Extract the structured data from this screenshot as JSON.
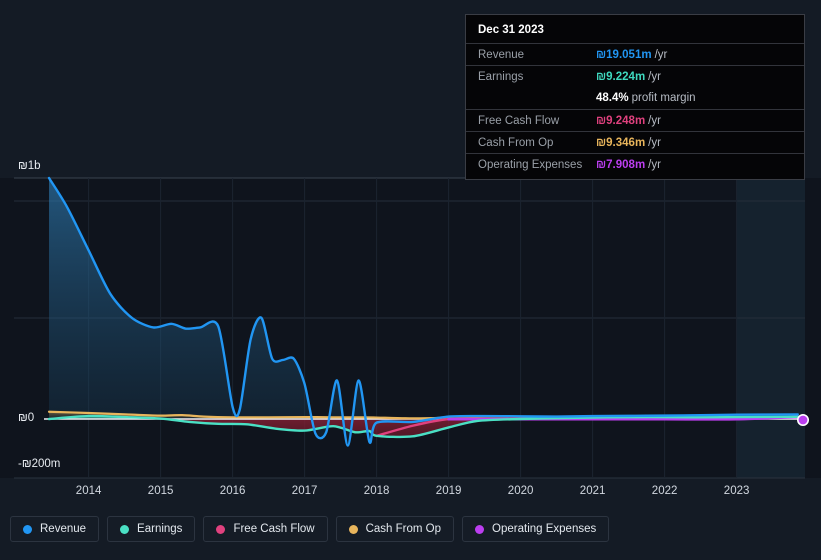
{
  "chart_data": {
    "type": "area",
    "title": "",
    "xlabel": "",
    "ylabel": "",
    "currency_symbol": "₪",
    "x": [
      2013.45,
      2014,
      2015,
      2016,
      2017,
      2018,
      2019,
      2020,
      2021,
      2022,
      2023,
      2023.85
    ],
    "xlim": [
      2013.45,
      2023.95
    ],
    "ylim": [
      -200000000,
      1050000000
    ],
    "grid": true,
    "legend_position": "bottom-left",
    "y_ticks": [
      {
        "label": "₪1b",
        "value": 1000000000
      },
      {
        "label": "₪0",
        "value": 0
      },
      {
        "label": "-₪200m",
        "value": -200000000
      }
    ],
    "x_ticks": [
      "2014",
      "2015",
      "2016",
      "2017",
      "2018",
      "2019",
      "2020",
      "2021",
      "2022",
      "2023"
    ],
    "forecast_band_start": "2023.0",
    "series": [
      {
        "name": "Revenue",
        "color": "#2196f3",
        "x": [
          2013.45,
          2013.7,
          2014.0,
          2014.3,
          2014.6,
          2014.9,
          2015.15,
          2015.35,
          2015.55,
          2015.8,
          2016.0,
          2016.1,
          2016.25,
          2016.4,
          2016.55,
          2016.7,
          2016.85,
          2017.0,
          2017.15,
          2017.3,
          2017.45,
          2017.6,
          2017.75,
          2017.9,
          2018.0,
          2018.5,
          2019.0,
          2019.5,
          2020.0,
          2020.5,
          2021.0,
          2021.5,
          2022.0,
          2022.5,
          2023.0,
          2023.85
        ],
        "values": [
          1000,
          880,
          700,
          520,
          420,
          380,
          395,
          375,
          380,
          385,
          50,
          40,
          330,
          420,
          250,
          245,
          250,
          145,
          -60,
          -55,
          160,
          -110,
          160,
          -95,
          -15,
          -12,
          10,
          12,
          11,
          10,
          12,
          13,
          14,
          16,
          18,
          19.051
        ],
        "units": "millions"
      },
      {
        "name": "Earnings",
        "color": "#4ae0c4",
        "x": [
          2013.45,
          2014.0,
          2014.5,
          2015.0,
          2015.4,
          2015.8,
          2016.2,
          2016.6,
          2017.0,
          2017.4,
          2017.7,
          2017.9,
          2018.0,
          2018.5,
          2019.0,
          2019.4,
          2020.0,
          2020.6,
          2021.2,
          2021.8,
          2022.4,
          2023.0,
          2023.85
        ],
        "values": [
          0,
          12,
          8,
          2,
          -12,
          -20,
          -22,
          -40,
          -48,
          -30,
          -55,
          -50,
          -70,
          -72,
          -35,
          -8,
          0,
          4,
          7,
          8,
          7,
          8,
          9.224
        ],
        "units": "millions"
      },
      {
        "name": "Free Cash Flow",
        "color": "#e0417e",
        "x": [
          2018.0,
          2018.5,
          2019.0,
          2019.5,
          2020.0,
          2021.0,
          2022.0,
          2023.0,
          2023.85
        ],
        "values": [
          -70,
          -28,
          0,
          1,
          1,
          1,
          1,
          1,
          9.248
        ],
        "units": "millions"
      },
      {
        "name": "Cash From Op",
        "color": "#e8b55c",
        "x": [
          2013.45,
          2014.0,
          2014.6,
          2015.0,
          2015.3,
          2015.6,
          2016.0,
          2016.5,
          2017.0,
          2017.4,
          2017.8,
          2018.0,
          2018.4,
          2018.8,
          2019.0,
          2019.5,
          2020.0,
          2021.0,
          2022.0,
          2023.0,
          2023.85
        ],
        "values": [
          30,
          25,
          18,
          14,
          16,
          10,
          7,
          7,
          8,
          7,
          7,
          6,
          3,
          4,
          6,
          3,
          2,
          2,
          2,
          2,
          9.346
        ],
        "units": "millions"
      },
      {
        "name": "Operating Expenses",
        "color": "#bb3ef0",
        "x": [
          2019.0,
          2019.5,
          2020.0,
          2021.0,
          2022.0,
          2023.0,
          2023.85
        ],
        "values": [
          -1,
          -1,
          -1,
          -1,
          -1,
          -1,
          7.908
        ],
        "units": "millions"
      }
    ]
  },
  "tooltip": {
    "date": "Dec 31 2023",
    "rows": [
      {
        "label": "Revenue",
        "value": "₪19.051m",
        "unit": "/yr",
        "color": "#2196f3"
      },
      {
        "label": "Earnings",
        "value": "₪9.224m",
        "unit": "/yr",
        "color": "#3fd9bf"
      },
      {
        "label": "Free Cash Flow",
        "value": "₪9.248m",
        "unit": "/yr",
        "color": "#e0417e"
      },
      {
        "label": "Cash From Op",
        "value": "₪9.346m",
        "unit": "/yr",
        "color": "#e8b55c"
      },
      {
        "label": "Operating Expenses",
        "value": "₪7.908m",
        "unit": "/yr",
        "color": "#bb3ef0"
      }
    ],
    "margin_value": "48.4%",
    "margin_label": "profit margin"
  },
  "legend": {
    "items": [
      {
        "label": "Revenue",
        "color": "#2196f3"
      },
      {
        "label": "Earnings",
        "color": "#4ae0c4"
      },
      {
        "label": "Free Cash Flow",
        "color": "#e0417e"
      },
      {
        "label": "Cash From Op",
        "color": "#e8b55c"
      },
      {
        "label": "Operating Expenses",
        "color": "#bb3ef0"
      }
    ]
  }
}
